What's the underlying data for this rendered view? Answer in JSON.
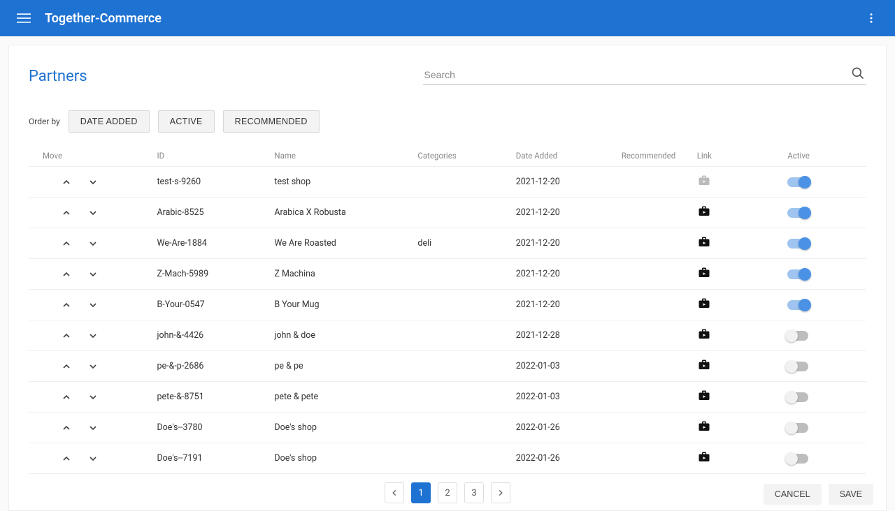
{
  "app": {
    "title": "Together-Commerce"
  },
  "page": {
    "title": "Partners"
  },
  "search": {
    "placeholder": "Search"
  },
  "order": {
    "label": "Order by",
    "buttons": [
      "DATE ADDED",
      "ACTIVE",
      "RECOMMENDED"
    ]
  },
  "columns": {
    "move": "Move",
    "id": "ID",
    "name": "Name",
    "categories": "Categories",
    "date_added": "Date Added",
    "recommended": "Recommended",
    "link": "Link",
    "active": "Active"
  },
  "rows": [
    {
      "id": "test-s-9260",
      "name": "test shop",
      "categories": "",
      "date": "2021-12-20",
      "link": false,
      "active": true
    },
    {
      "id": "Arabic-8525",
      "name": "Arabica X Robusta",
      "categories": "",
      "date": "2021-12-20",
      "link": true,
      "active": true
    },
    {
      "id": "We-Are-1884",
      "name": "We Are Roasted",
      "categories": "deli",
      "date": "2021-12-20",
      "link": true,
      "active": true
    },
    {
      "id": "Z-Mach-5989",
      "name": "Z Machina",
      "categories": "",
      "date": "2021-12-20",
      "link": true,
      "active": true
    },
    {
      "id": "B-Your-0547",
      "name": "B Your Mug",
      "categories": "",
      "date": "2021-12-20",
      "link": true,
      "active": true
    },
    {
      "id": "john-&-4426",
      "name": "john & doe",
      "categories": "",
      "date": "2021-12-28",
      "link": true,
      "active": false
    },
    {
      "id": "pe-&-p-2686",
      "name": "pe & pe",
      "categories": "",
      "date": "2022-01-03",
      "link": true,
      "active": false
    },
    {
      "id": "pete-&-8751",
      "name": "pete & pete",
      "categories": "",
      "date": "2022-01-03",
      "link": true,
      "active": false
    },
    {
      "id": "Doe's--3780",
      "name": "Doe's shop",
      "categories": "",
      "date": "2022-01-26",
      "link": true,
      "active": false
    },
    {
      "id": "Doe's--7191",
      "name": "Doe's shop",
      "categories": "",
      "date": "2022-01-26",
      "link": true,
      "active": false
    }
  ],
  "pagination": {
    "pages": [
      "1",
      "2",
      "3"
    ],
    "current": 1
  },
  "footer": {
    "cancel": "CANCEL",
    "save": "SAVE"
  }
}
